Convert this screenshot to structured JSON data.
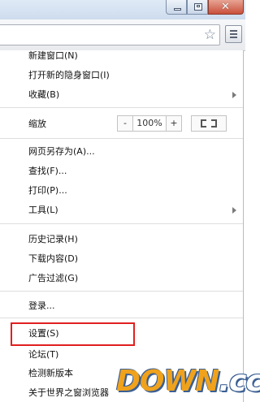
{
  "window": {
    "close_glyph": "✕"
  },
  "toolbar": {
    "star_glyph": "☆"
  },
  "menu": {
    "new_window": "新建窗口(N)",
    "new_incognito": "打开新的隐身窗口(I)",
    "bookmarks": "收藏(B)",
    "zoom_label": "缩放",
    "zoom_minus": "-",
    "zoom_value": "100%",
    "zoom_plus": "+",
    "save_as": "网页另存为(A)...",
    "find": "查找(F)...",
    "print": "打印(P)...",
    "tools": "工具(L)",
    "history": "历史记录(H)",
    "downloads": "下载内容(D)",
    "ad_filter": "广告过滤(G)",
    "login": "登录...",
    "settings": "设置(S)",
    "forum": "论坛(T)",
    "check_update": "检测新版本",
    "about": "关于世界之窗浏览器"
  },
  "watermark": {
    "main": "DOWN",
    "suffix": ".cc"
  },
  "colors": {
    "highlight": "#e02020",
    "watermark_orange": "#f0a21c",
    "watermark_blue": "#3b5f92"
  }
}
